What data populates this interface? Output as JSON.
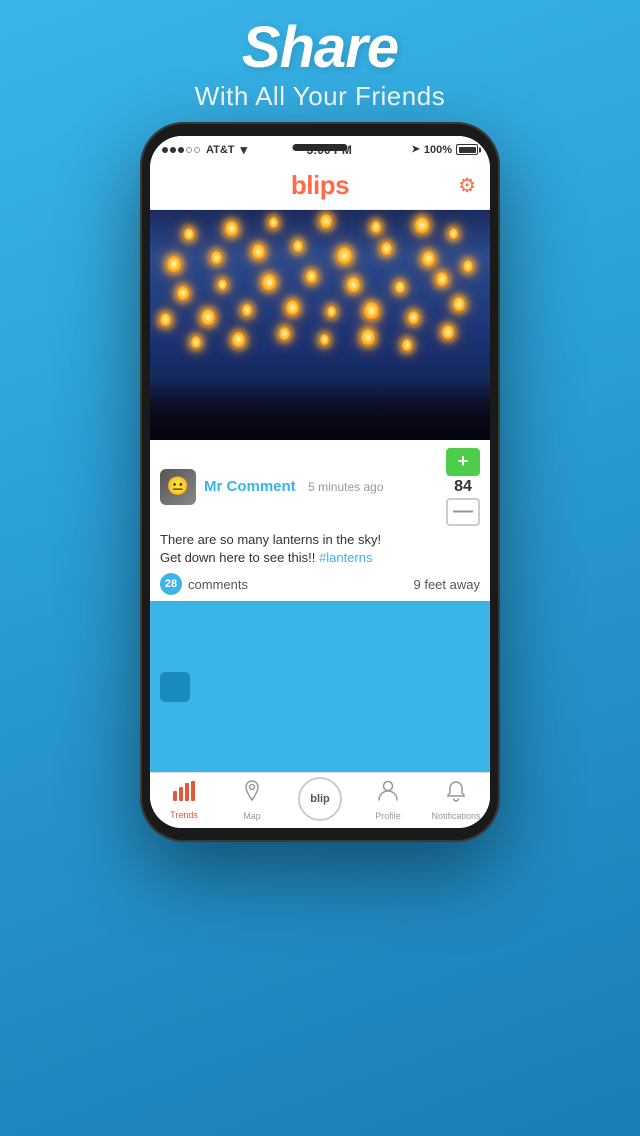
{
  "promo": {
    "title": "Share",
    "subtitle": "With All Your Friends"
  },
  "status_bar": {
    "signal": [
      "filled",
      "filled",
      "filled",
      "empty",
      "empty"
    ],
    "carrier": "AT&T",
    "wifi": "wifi",
    "time": "3:00 PM",
    "battery_pct": "100%"
  },
  "app_header": {
    "logo": "blips",
    "settings_label": "settings"
  },
  "post": {
    "username": "Mr Comment",
    "timestamp": "5 minutes ago",
    "body_line1": "There are so many lanterns in the sky!",
    "body_line2": "Get down here to see this!! #lanterns",
    "hashtag": "#lanterns",
    "comments_count": "28",
    "comments_label": "comments",
    "distance": "9 feet away",
    "vote_count": "84",
    "vote_up_label": "+",
    "vote_down_label": "—"
  },
  "tab_bar": {
    "items": [
      {
        "id": "trends",
        "label": "Trends",
        "active": true
      },
      {
        "id": "map",
        "label": "Map",
        "active": false
      },
      {
        "id": "blip",
        "label": "blip",
        "active": false
      },
      {
        "id": "profile",
        "label": "Profile",
        "active": false
      },
      {
        "id": "notifications",
        "label": "Notifications",
        "active": false
      }
    ]
  }
}
